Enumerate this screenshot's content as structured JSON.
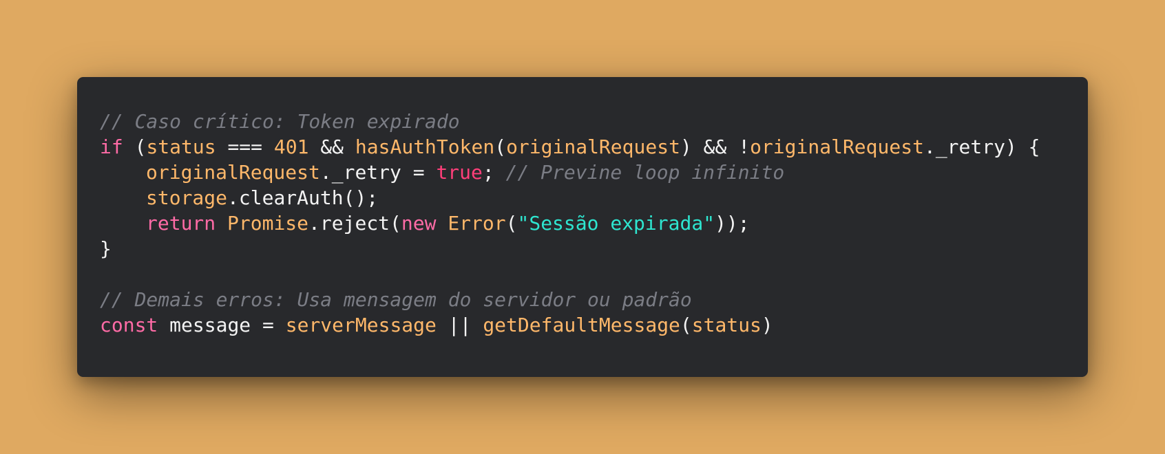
{
  "code": {
    "line1": {
      "comment": "// Caso crítico: Token expirado"
    },
    "line2": {
      "kw_if": "if",
      "p1": " (",
      "status": "status",
      "p2": " === ",
      "num401": "401",
      "p3": " && ",
      "fn_hasAuthToken": "hasAuthToken",
      "p4": "(",
      "originalRequest_a": "originalRequest",
      "p5": ") && !",
      "originalRequest_b": "originalRequest",
      "p6": "._retry) {"
    },
    "line3": {
      "originalRequest": "originalRequest",
      "p1": "._retry = ",
      "bool_true": "true",
      "p2": "; ",
      "comment": "// Previne loop infinito"
    },
    "line4": {
      "storage": "storage",
      "p1": ".clearAuth();"
    },
    "line5": {
      "kw_return": "return",
      "p1": " ",
      "promise": "Promise",
      "p2": ".reject(",
      "kw_new": "new",
      "p3": " ",
      "error": "Error",
      "p4": "(",
      "str": "\"Sessão expirada\"",
      "p5": "));"
    },
    "line6": {
      "brace": "}"
    },
    "line8": {
      "comment": "// Demais erros: Usa mensagem do servidor ou padrão"
    },
    "line9": {
      "kw_const": "const",
      "p1": " message = ",
      "serverMessage": "serverMessage",
      "p2": " || ",
      "fn_getDefaultMessage": "getDefaultMessage",
      "p3": "(",
      "status": "status",
      "p4": ")"
    }
  },
  "colors": {
    "background": "#dfa961",
    "editor": "#28292c",
    "comment": "#7b7d85",
    "keyword": "#ff6ba6",
    "function": "#ffb86a",
    "boolean": "#ff3f7a",
    "string": "#2ee6d0",
    "plain": "#f3f3f3"
  }
}
